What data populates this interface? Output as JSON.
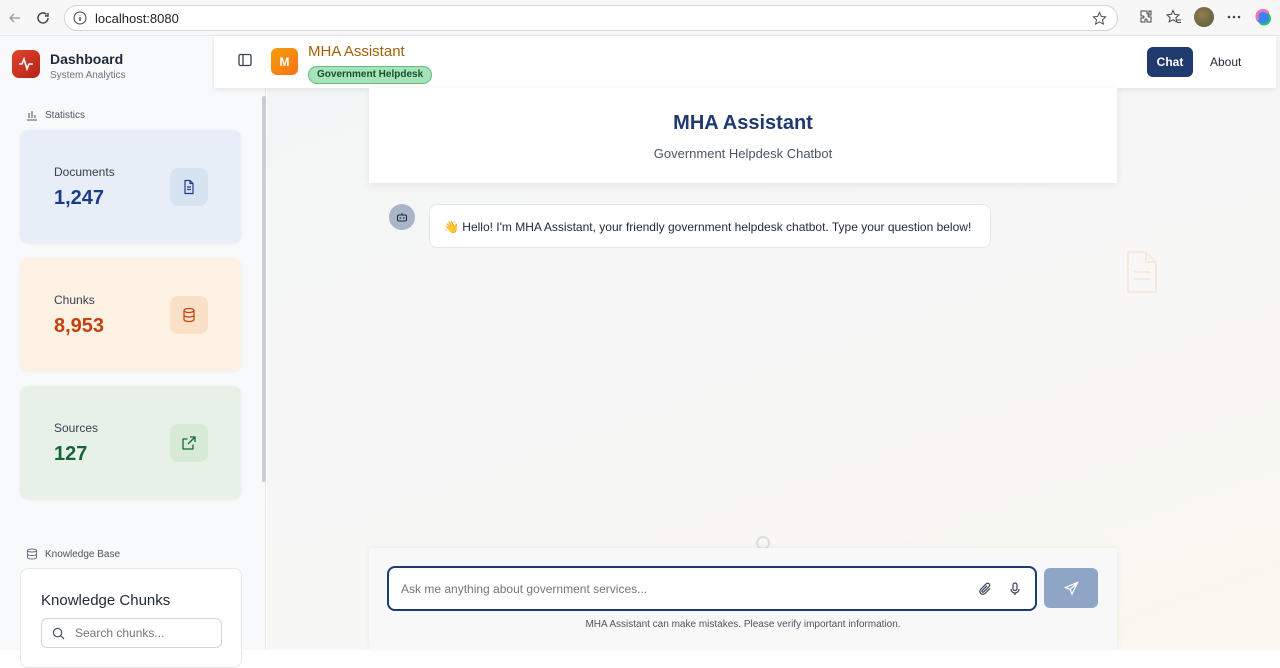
{
  "browser": {
    "url": "localhost:8080"
  },
  "sidebar": {
    "brand_title": "Dashboard",
    "brand_subtitle": "System Analytics",
    "statistics_label": "Statistics",
    "stats": [
      {
        "label": "Documents",
        "value": "1,247",
        "color": "#1e3a8a",
        "bg": "#e7eef7",
        "icon_bg": "#d8e3f2",
        "icon": "document-icon"
      },
      {
        "label": "Chunks",
        "value": "8,953",
        "color": "#c2410c",
        "bg": "#fdf1e4",
        "icon_bg": "#fbe0c8",
        "icon": "database-icon"
      },
      {
        "label": "Sources",
        "value": "127",
        "color": "#166534",
        "bg": "#e8f1e8",
        "icon_bg": "#d7ead8",
        "icon": "external-link-icon"
      }
    ],
    "knowledge_base_label": "Knowledge Base",
    "knowledge_title": "Knowledge Chunks",
    "search_placeholder": "Search chunks..."
  },
  "topbar": {
    "logo_letter": "M",
    "title": "MHA Assistant",
    "badge": "Government Helpdesk",
    "nav": {
      "chat": "Chat",
      "about": "About"
    }
  },
  "header": {
    "title": "MHA Assistant",
    "subtitle": "Government Helpdesk Chatbot"
  },
  "messages": [
    {
      "sender": "bot",
      "text": "👋 Hello! I'm MHA Assistant, your friendly government helpdesk chatbot. Type your question below!"
    }
  ],
  "composer": {
    "placeholder": "Ask me anything about government services...",
    "disclaimer": "MHA Assistant can make mistakes. Please verify important information."
  },
  "colors": {
    "primary": "#1e3a6e",
    "accent": "#f59e0b",
    "badge": "#a7e2b8"
  }
}
